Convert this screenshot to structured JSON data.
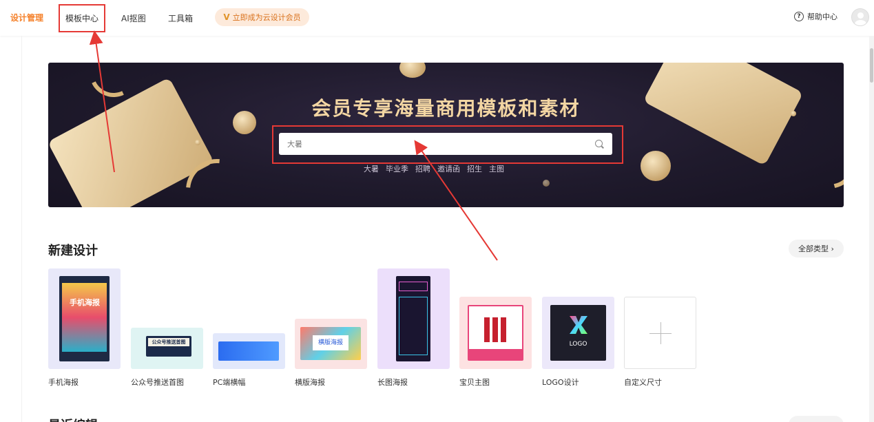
{
  "nav": {
    "brand": "设计管理",
    "items": [
      "模板中心",
      "AI抠图",
      "工具箱"
    ],
    "vip_label": "立即成为云设计会员",
    "vip_mark": "V",
    "help_label": "帮助中心"
  },
  "banner": {
    "title": "会员专享海量商用模板和素材",
    "search_placeholder": "大暑",
    "hot_tags": [
      "大暑",
      "毕业季",
      "招聘",
      "邀请函",
      "招生",
      "主图"
    ]
  },
  "new_design": {
    "title": "新建设计",
    "all_types": "全部类型",
    "templates": [
      {
        "label": "手机海报",
        "thumb_text": "手机海报"
      },
      {
        "label": "公众号推送首图",
        "thumb_text": "公众号推送首图"
      },
      {
        "label": "PC端横幅",
        "thumb_text": ""
      },
      {
        "label": "横版海报",
        "thumb_text": "横版海报"
      },
      {
        "label": "长图海报",
        "thumb_text": ""
      },
      {
        "label": "宝贝主图",
        "thumb_text": ""
      },
      {
        "label": "LOGO设计",
        "thumb_text": "LOGO"
      },
      {
        "label": "自定义尺寸",
        "thumb_text": ""
      }
    ]
  },
  "recent": {
    "title": "最近编辑"
  },
  "colors": {
    "brand": "#f5812b",
    "annotation_red": "#e53935",
    "banner_bg": "#1f1a2c",
    "banner_title": "#f3d6a3"
  }
}
